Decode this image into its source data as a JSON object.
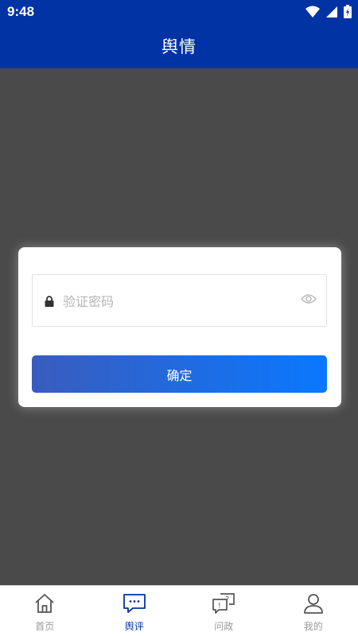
{
  "status_bar": {
    "time": "9:48"
  },
  "header": {
    "title": "舆情"
  },
  "dialog": {
    "password_placeholder": "验证密码",
    "password_value": "",
    "confirm_label": "确定"
  },
  "tabs": [
    {
      "label": "首页",
      "icon": "home-icon",
      "active": false
    },
    {
      "label": "舆评",
      "icon": "chat-bubble-icon",
      "active": true
    },
    {
      "label": "问政",
      "icon": "question-chat-icon",
      "active": false
    },
    {
      "label": "我的",
      "icon": "user-icon",
      "active": false
    }
  ],
  "colors": {
    "primary": "#0133a5",
    "overlay": "#4a4a4a",
    "button_gradient_start": "#3a5cbd",
    "button_gradient_end": "#0a78ff",
    "tab_inactive": "#9a9a9a"
  }
}
